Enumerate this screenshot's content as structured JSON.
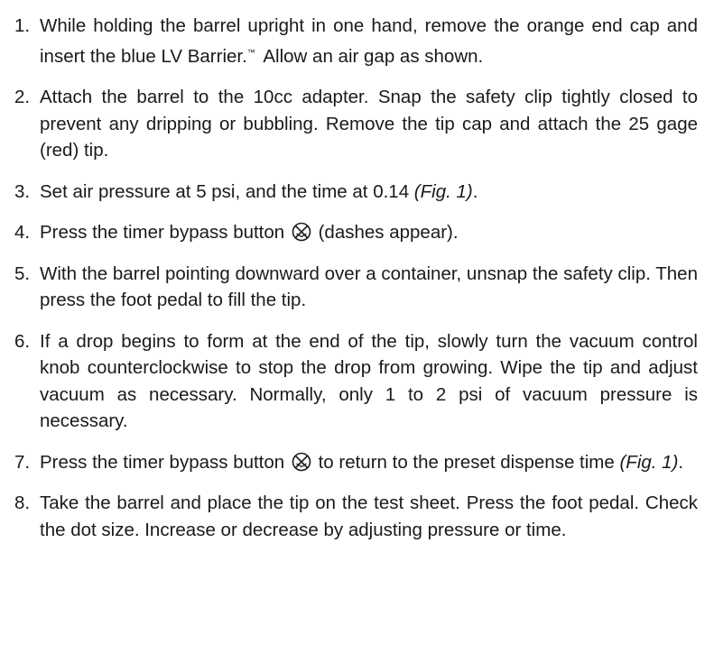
{
  "steps": [
    {
      "number": "1.",
      "text_a": "While holding the barrel upright in one hand, remove the orange end cap and insert the blue LV Barrier.",
      "trademark": "™",
      "text_b": " Allow an air gap as shown."
    },
    {
      "number": "2.",
      "text": "Attach the barrel to the 10cc adapter. Snap the safety clip tightly closed to prevent any dripping or bubbling. Remove the tip cap and attach the 25 gage (red) tip."
    },
    {
      "number": "3.",
      "text_a": "Set air pressure at 5 psi, and the time at 0.14 ",
      "figure_ref": "(Fig. 1)",
      "text_b": "."
    },
    {
      "number": "4.",
      "text_a": "Press the timer bypass button ",
      "icon": "timer-bypass-icon",
      "text_b": " (dashes appear)."
    },
    {
      "number": "5.",
      "text": "With the barrel pointing downward over a container, unsnap the safety clip. Then press the foot pedal to fill the tip."
    },
    {
      "number": "6.",
      "text": "If a drop begins to form at the end of the tip, slowly turn the vacuum control knob counterclockwise to stop the drop from growing. Wipe the tip and adjust vacuum as necessary. Normally, only 1 to 2 psi of vacuum pressure is necessary."
    },
    {
      "number": "7.",
      "text_a": "Press the  timer bypass button ",
      "icon": "timer-bypass-icon",
      "text_b": " to return to the preset dispense time ",
      "figure_ref": "(Fig. 1)",
      "text_c": "."
    },
    {
      "number": "8.",
      "text": "Take the barrel and place the tip on the test sheet. Press the foot pedal. Check the dot size. Increase or decrease by adjusting pressure or time."
    }
  ]
}
